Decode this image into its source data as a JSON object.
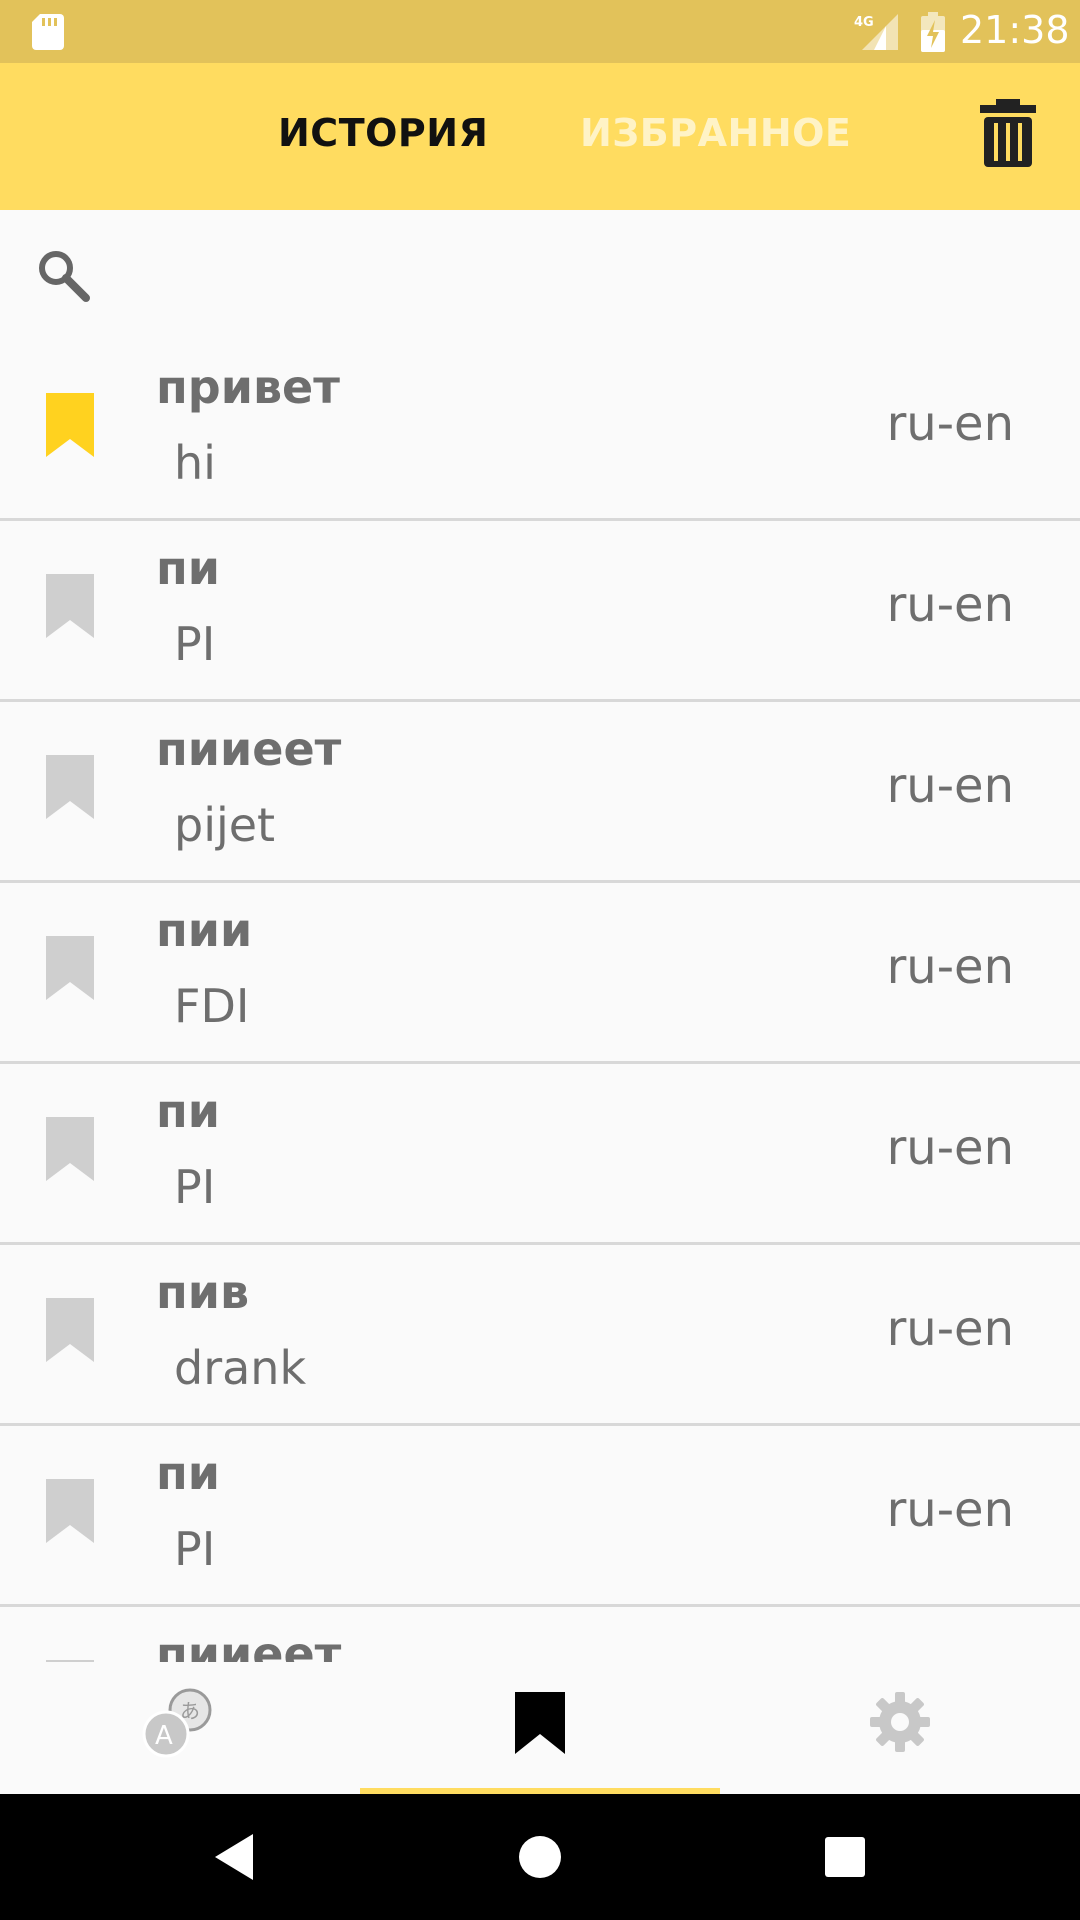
{
  "status_bar": {
    "time": "21:38",
    "network_label": "4G"
  },
  "header": {
    "tabs": [
      {
        "label": "ИСТОРИЯ",
        "active": true
      },
      {
        "label": "ИЗБРАННОЕ",
        "active": false
      }
    ],
    "delete_icon": "trash-icon"
  },
  "search": {
    "placeholder": "",
    "value": ""
  },
  "history": [
    {
      "word": "привет",
      "translation": "hi",
      "lang": "ru-en",
      "favorite": true
    },
    {
      "word": "пи",
      "translation": "PI",
      "lang": "ru-en",
      "favorite": false
    },
    {
      "word": "пииеет",
      "translation": "pijet",
      "lang": "ru-en",
      "favorite": false
    },
    {
      "word": "пии",
      "translation": "FDI",
      "lang": "ru-en",
      "favorite": false
    },
    {
      "word": "пи",
      "translation": "PI",
      "lang": "ru-en",
      "favorite": false
    },
    {
      "word": "пив",
      "translation": "drank",
      "lang": "ru-en",
      "favorite": false
    },
    {
      "word": "пи",
      "translation": "PI",
      "lang": "ru-en",
      "favorite": false
    },
    {
      "word": "пииеет",
      "translation": "",
      "lang": "",
      "favorite": false
    }
  ],
  "bottom_nav": {
    "items": [
      {
        "icon": "translate-icon",
        "active": false
      },
      {
        "icon": "bookmark-icon",
        "active": true
      },
      {
        "icon": "gear-icon",
        "active": false
      }
    ]
  },
  "colors": {
    "accent": "#ffdc60",
    "status_bar": "#e2c25a",
    "bookmark_active": "#ffd21f",
    "bookmark_inactive": "#cfcfcf",
    "text": "#6e6e6e"
  }
}
